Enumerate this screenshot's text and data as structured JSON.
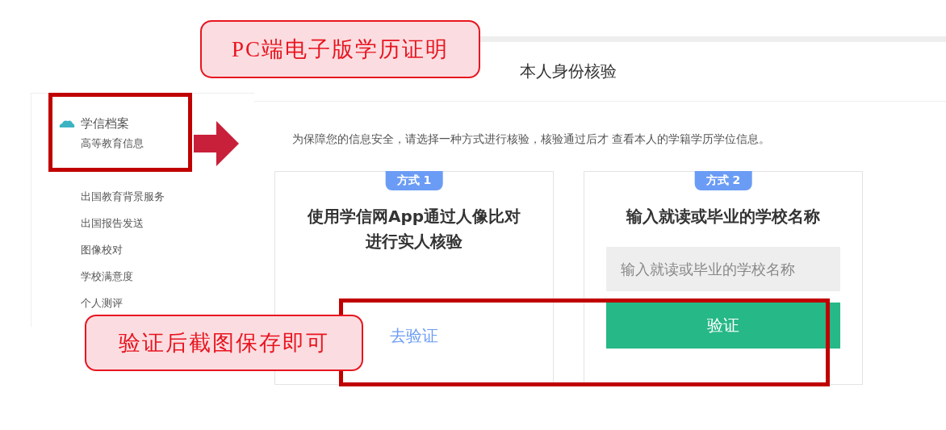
{
  "annotations": {
    "callouts": [
      {
        "text": "PC端电子版学历证明"
      },
      {
        "text": "验证后截图保存即可"
      }
    ]
  },
  "sidebar": {
    "section": "学信档案",
    "items": [
      {
        "label": "高等教育信息"
      },
      {
        "label": "出国教育背景服务"
      },
      {
        "label": "出国报告发送"
      },
      {
        "label": "图像校对"
      },
      {
        "label": "学校满意度"
      },
      {
        "label": "个人测评"
      }
    ]
  },
  "main": {
    "title": "本人身份核验",
    "notice": "为保障您的信息安全，请选择一种方式进行核验，核验通过后才 查看本人的学籍学历学位信息。",
    "methods": [
      {
        "kind": "app",
        "badge": "方式 1",
        "title": "使用学信网App通过人像比对进行实人核验",
        "link": "去验证"
      },
      {
        "kind": "school",
        "badge": "方式 2",
        "title": "输入就读或毕业的学校名称",
        "placeholder": "输入就读或毕业的学校名称",
        "button": "验证"
      }
    ]
  }
}
